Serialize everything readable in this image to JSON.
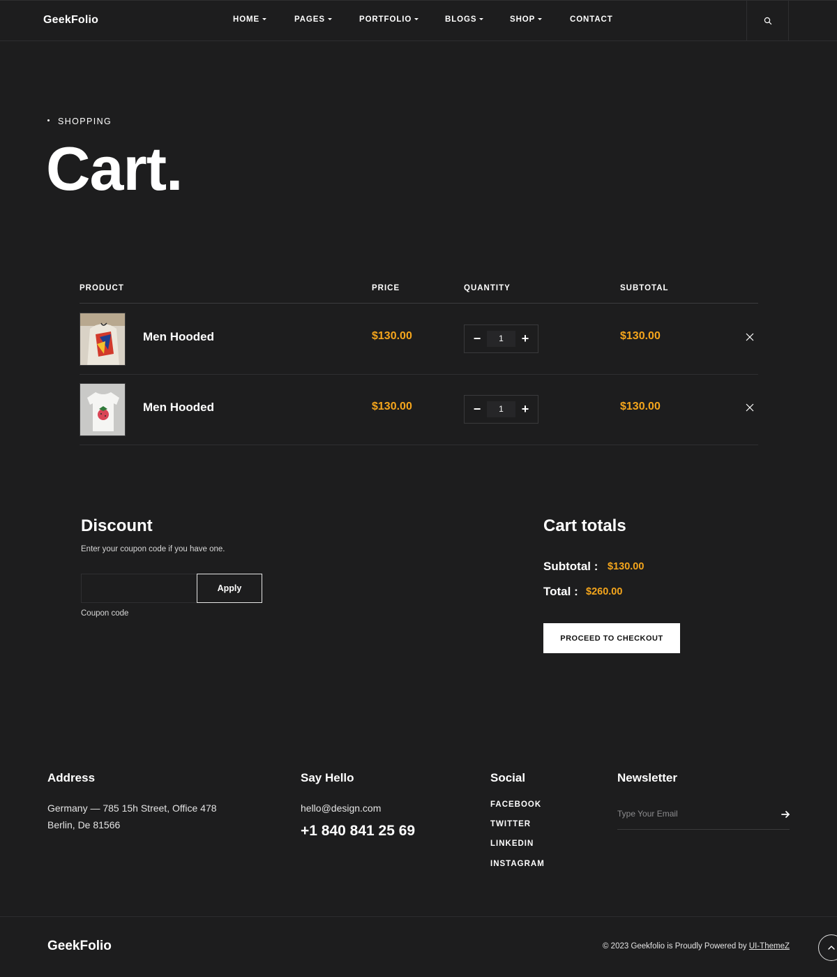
{
  "header": {
    "logo": "GeekFolio",
    "nav": [
      {
        "label": "HOME",
        "dropdown": true
      },
      {
        "label": "PAGES",
        "dropdown": true
      },
      {
        "label": "PORTFOLIO",
        "dropdown": true
      },
      {
        "label": "BLOGS",
        "dropdown": true
      },
      {
        "label": "SHOP",
        "dropdown": true
      },
      {
        "label": "CONTACT",
        "dropdown": false
      }
    ],
    "search_icon": "search-icon"
  },
  "hero": {
    "breadcrumb": "SHOPPING",
    "title": "Cart."
  },
  "cart": {
    "columns": {
      "product": "PRODUCT",
      "price": "PRICE",
      "quantity": "QUANTITY",
      "subtotal": "SUBTOTAL"
    },
    "items": [
      {
        "name": "Men Hooded",
        "price": "$130.00",
        "quantity": "1",
        "subtotal": "$130.00",
        "image": "hoodie-product-image"
      },
      {
        "name": "Men Hooded",
        "price": "$130.00",
        "quantity": "1",
        "subtotal": "$130.00",
        "image": "tshirt-product-image"
      }
    ],
    "minus": "−",
    "plus": "+"
  },
  "discount": {
    "title": "Discount",
    "description": "Enter your coupon code if you have one.",
    "input_value": "",
    "apply_label": "Apply",
    "coupon_label": "Coupon code"
  },
  "totals": {
    "title": "Cart totals",
    "subtotal_label": "Subtotal :",
    "subtotal_value": "$130.00",
    "total_label": "Total :",
    "total_value": "$260.00",
    "checkout_label": "PROCEED TO CHECKOUT"
  },
  "footer": {
    "address": {
      "title": "Address",
      "line1": "Germany — 785 15h Street, Office 478",
      "line2": "Berlin, De 81566"
    },
    "hello": {
      "title": "Say Hello",
      "email": "hello@design.com",
      "phone": "+1 840 841 25 69"
    },
    "social": {
      "title": "Social",
      "links": [
        "FACEBOOK",
        "TWITTER",
        "LINKEDIN",
        "INSTAGRAM"
      ]
    },
    "newsletter": {
      "title": "Newsletter",
      "placeholder": "Type Your Email"
    },
    "logo": "GeekFolio",
    "copyright_prefix": "© 2023 Geekfolio is Proudly Powered by ",
    "copyright_link": "UI-ThemeZ"
  },
  "colors": {
    "accent": "#f4a51c",
    "background": "#1d1d1e",
    "text": "#ffffff"
  }
}
